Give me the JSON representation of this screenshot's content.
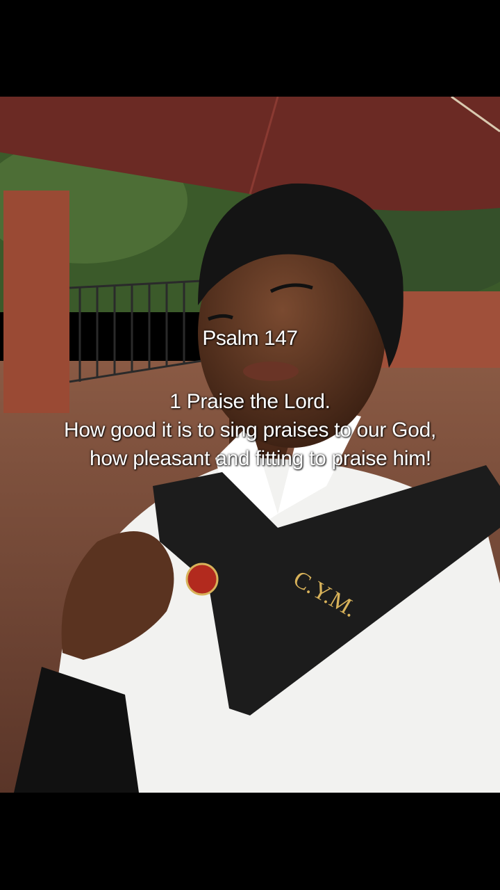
{
  "caption": {
    "title": "Psalm 147",
    "lines": [
      "1 Praise the Lord.",
      "How good it is to sing praises to our God,",
      "how pleasant and fitting to praise him!"
    ]
  },
  "badge_text": "C.Y.M.",
  "colors": {
    "umbrella": "#6b2a24",
    "brick": "#a0503a",
    "shirt": "#f2f2f0",
    "sash": "#1c1c1c",
    "headwrap": "#141414",
    "skin": "#5a3320",
    "tree": "#3b5a2a"
  }
}
